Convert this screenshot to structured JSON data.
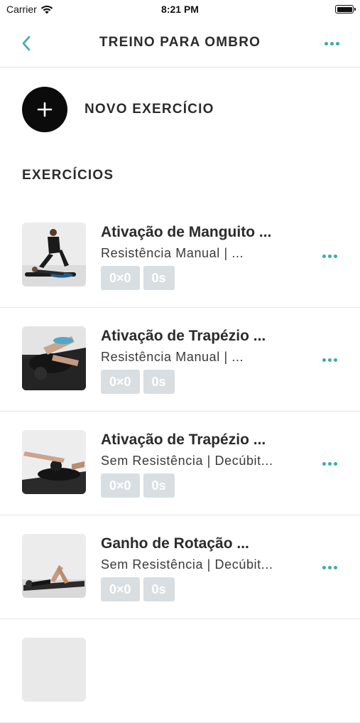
{
  "status": {
    "carrier": "Carrier",
    "time": "8:21 PM",
    "battery_level": 1.0
  },
  "nav": {
    "title": "TREINO PARA OMBRO"
  },
  "add": {
    "label": "NOVO EXERCÍCIO"
  },
  "section": {
    "title": "EXERCÍCIOS"
  },
  "colors": {
    "accent": "#3aada5",
    "badge": "#d8dee2",
    "button": "#0b0b0b"
  },
  "exercises": [
    {
      "title": "Ativação de Manguito ...",
      "subtitle": "Resistência Manual | ...",
      "sets": "0×0",
      "time": "0s"
    },
    {
      "title": "Ativação de Trapézio ...",
      "subtitle": "Resistência Manual | ...",
      "sets": "0×0",
      "time": "0s"
    },
    {
      "title": "Ativação de Trapézio ...",
      "subtitle": "Sem Resistência | Decúbit...",
      "sets": "0×0",
      "time": "0s"
    },
    {
      "title": "Ganho de Rotação ...",
      "subtitle": "Sem Resistência | Decúbit...",
      "sets": "0×0",
      "time": "0s"
    }
  ]
}
